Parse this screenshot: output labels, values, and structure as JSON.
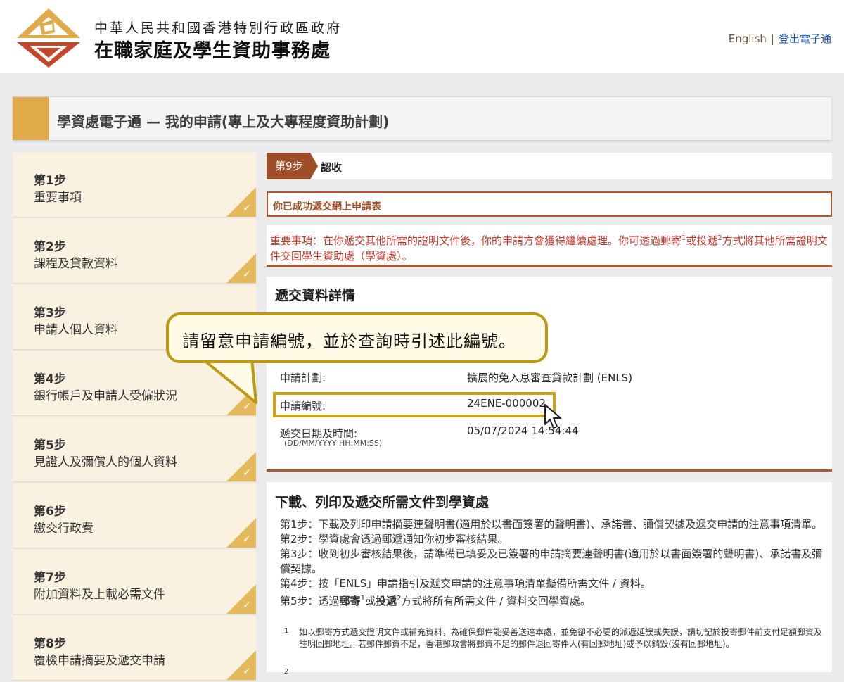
{
  "header": {
    "org_line1": "中華人民共和國香港特別行政區政府",
    "org_line2": "在職家庭及學生資助事務處",
    "link_english": "English",
    "link_sep": "|",
    "link_logout": "登出電子通"
  },
  "title_bar": {
    "title": "學資處電子通 — 我的申請(專上及大專程度資助計劃)"
  },
  "sidebar": {
    "items": [
      {
        "num": "第1步",
        "label": "重要事項"
      },
      {
        "num": "第2步",
        "label": "課程及貸款資料"
      },
      {
        "num": "第3步",
        "label": "申請人個人資料"
      },
      {
        "num": "第4步",
        "label": "銀行帳戶及申請人受僱狀況"
      },
      {
        "num": "第5步",
        "label": "見證人及彌償人的個人資料"
      },
      {
        "num": "第6步",
        "label": "繳交行政費"
      },
      {
        "num": "第7步",
        "label": "附加資料及上載必需文件"
      },
      {
        "num": "第8步",
        "label": "覆檢申請摘要及遞交申請"
      }
    ],
    "check_mark": "✓"
  },
  "main": {
    "step_badge": "第9步",
    "step_title": "認收",
    "success": "你已成功遞交網上申請表",
    "important_pre": "重要事項：在你遞交其他所需的證明文件後，你的申請方會獲得繼續處理。你可透過郵寄",
    "sup1": "1",
    "important_mid": "或投遞",
    "sup2": "2",
    "important_post": "方式將其他所需證明文件交回學生資助處（學資處）。",
    "details_heading": "遞交資料詳情",
    "scheme_label": "申請計劃:",
    "scheme_value": "擴展的免入息審查貸款計劃 (ENLS)",
    "app_no_label": "申請編號:",
    "app_no_value": "24ENE-000002",
    "date_label": "遞交日期及時間:",
    "date_hint": "(DD/MM/YYYY HH:MM:SS)",
    "date_value": "05/07/2024 14:54:44",
    "download_heading": "下載、列印及遞交所需文件到學資處",
    "dl_step1": "第1步：下載及列印申請摘要連聲明書(適用於以書面簽署的聲明書)、承諾書、彌償契據及遞交申請的注意事項清單。",
    "dl_step2": "第2步：學資處會透過郵遞通知你初步審核結果。",
    "dl_step3": "第3步：收到初步審核結果後，請準備已填妥及已簽署的申請摘要連聲明書(適用於以書面簽署的聲明書)、承諾書及彌償契據。",
    "dl_step4": "第4步：按「ENLS」申請指引及遞交申請的注意事項清單擬備所需文件 / 資料。",
    "dl_step5_pre": "第5步：透過",
    "dl_step5_mail": "郵寄",
    "dl_step5_or": "或",
    "dl_step5_drop": "投遞",
    "dl_step5_post": "方式將所有所需文件 / 資料交回學資處。",
    "footnote1": "如以郵寄方式遞交證明文件或補充資料，為確保郵件能妥善送達本處，並免卻不必要的派遞延誤或失誤，請切記於投寄郵件前支付足額郵資及註明回郵地址。若郵件郵資不足，香港郵政會將郵資不足的郵件退回寄件人(有回郵地址)或予以銷毀(沒有回郵地址)。",
    "footnote2_num": "2"
  },
  "callout": {
    "text": "請留意申請編號，並於查詢時引述此編號。"
  },
  "colors": {
    "accent_gold": "#e0a94a",
    "brown": "#9e4f2a",
    "red_text": "#c0392b",
    "callout_border": "#bd9a12"
  }
}
